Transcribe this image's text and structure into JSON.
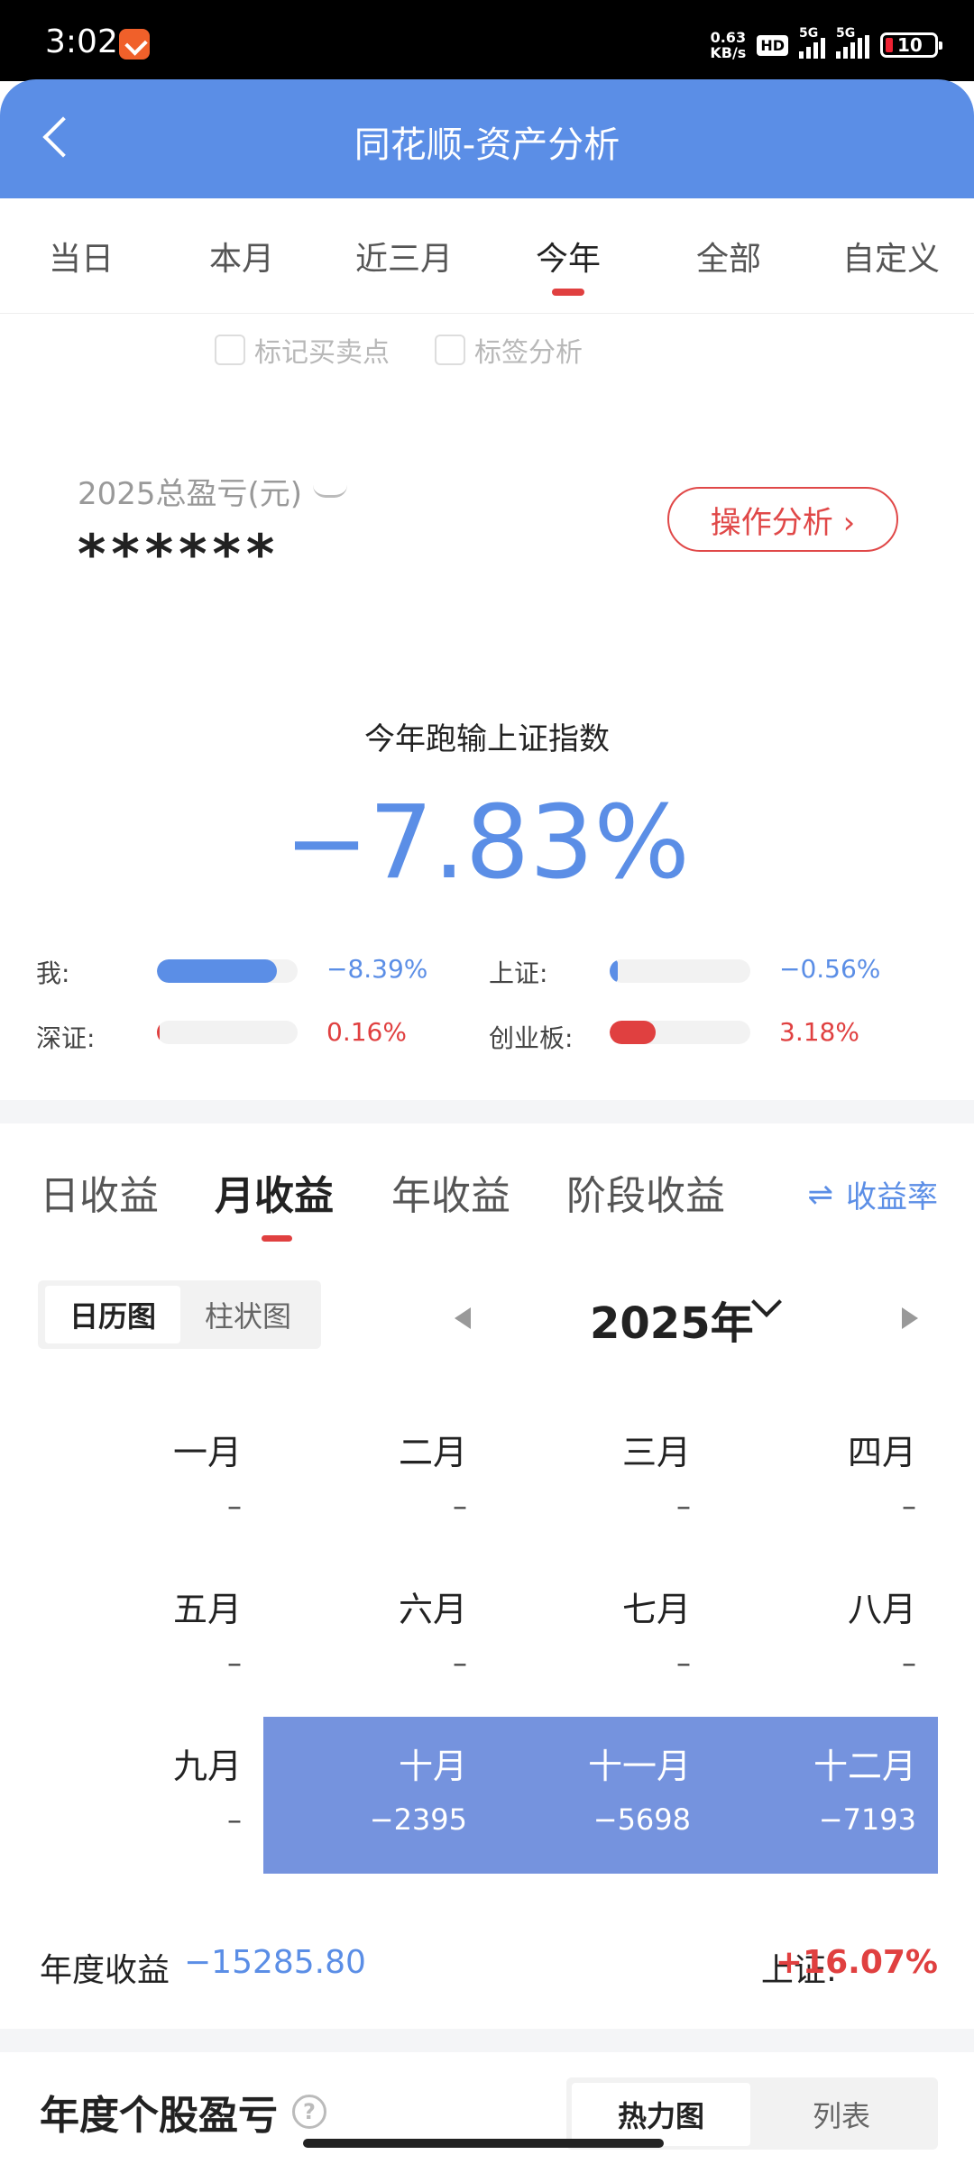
{
  "status_bar": {
    "time": "3:02",
    "speed_line1": "0.63",
    "speed_line2": "KB/s",
    "hd": "HD",
    "net1": "5G",
    "net2": "5G",
    "battery": "10",
    "battery_color": "#e02233"
  },
  "header": {
    "title": "同花顺-资产分析",
    "color": "#5b8ee6"
  },
  "period_tabs": [
    {
      "label": "当日"
    },
    {
      "label": "本月"
    },
    {
      "label": "近三月"
    },
    {
      "label": "今年"
    },
    {
      "label": "全部"
    },
    {
      "label": "自定义"
    }
  ],
  "period_active": "今年",
  "checkboxes": [
    {
      "label": "标记买卖点",
      "checked": false
    },
    {
      "label": "标签分析",
      "checked": false
    }
  ],
  "pnl": {
    "label": "2025总盈亏(元)",
    "value": "******",
    "op_button": "操作分析 ›"
  },
  "benchmark": {
    "title": "今年跑输上证指数",
    "value": "−7.83%"
  },
  "compare": [
    {
      "name": "我:",
      "value": "−8.39%",
      "fill": 0.85,
      "color": "#5b8ee6"
    },
    {
      "name": "上证:",
      "value": "−0.56%",
      "fill": 0.06,
      "color": "#5b8ee6"
    },
    {
      "name": "深证:",
      "value": "0.16%",
      "fill": 0.02,
      "color": "#e04040"
    },
    {
      "name": "创业板:",
      "value": "3.18%",
      "fill": 0.33,
      "color": "#e04040"
    }
  ],
  "return_tabs": [
    {
      "label": "日收益"
    },
    {
      "label": "月收益"
    },
    {
      "label": "年收益"
    },
    {
      "label": "阶段收益"
    }
  ],
  "return_active": "月收益",
  "rate_link": "收益率",
  "view_toggle": {
    "active": "日历图",
    "other": "柱状图"
  },
  "year_selector": {
    "label": "2025年"
  },
  "months": [
    {
      "name": "一月",
      "value": "–"
    },
    {
      "name": "二月",
      "value": "–"
    },
    {
      "name": "三月",
      "value": "–"
    },
    {
      "name": "四月",
      "value": "–"
    },
    {
      "name": "五月",
      "value": "–"
    },
    {
      "name": "六月",
      "value": "–"
    },
    {
      "name": "七月",
      "value": "–"
    },
    {
      "name": "八月",
      "value": "–"
    },
    {
      "name": "九月",
      "value": "–"
    },
    {
      "name": "十月",
      "value": "−2395"
    },
    {
      "name": "十一月",
      "value": "−5698"
    },
    {
      "name": "十二月",
      "value": "−7193"
    }
  ],
  "annual": {
    "label": "年度收益",
    "value": "−15285.80",
    "sz_label": "上证:",
    "sz_value": "+16.07%"
  },
  "stock_section": {
    "title": "年度个股盈亏",
    "toggle_active": "热力图",
    "toggle_other": "列表"
  }
}
